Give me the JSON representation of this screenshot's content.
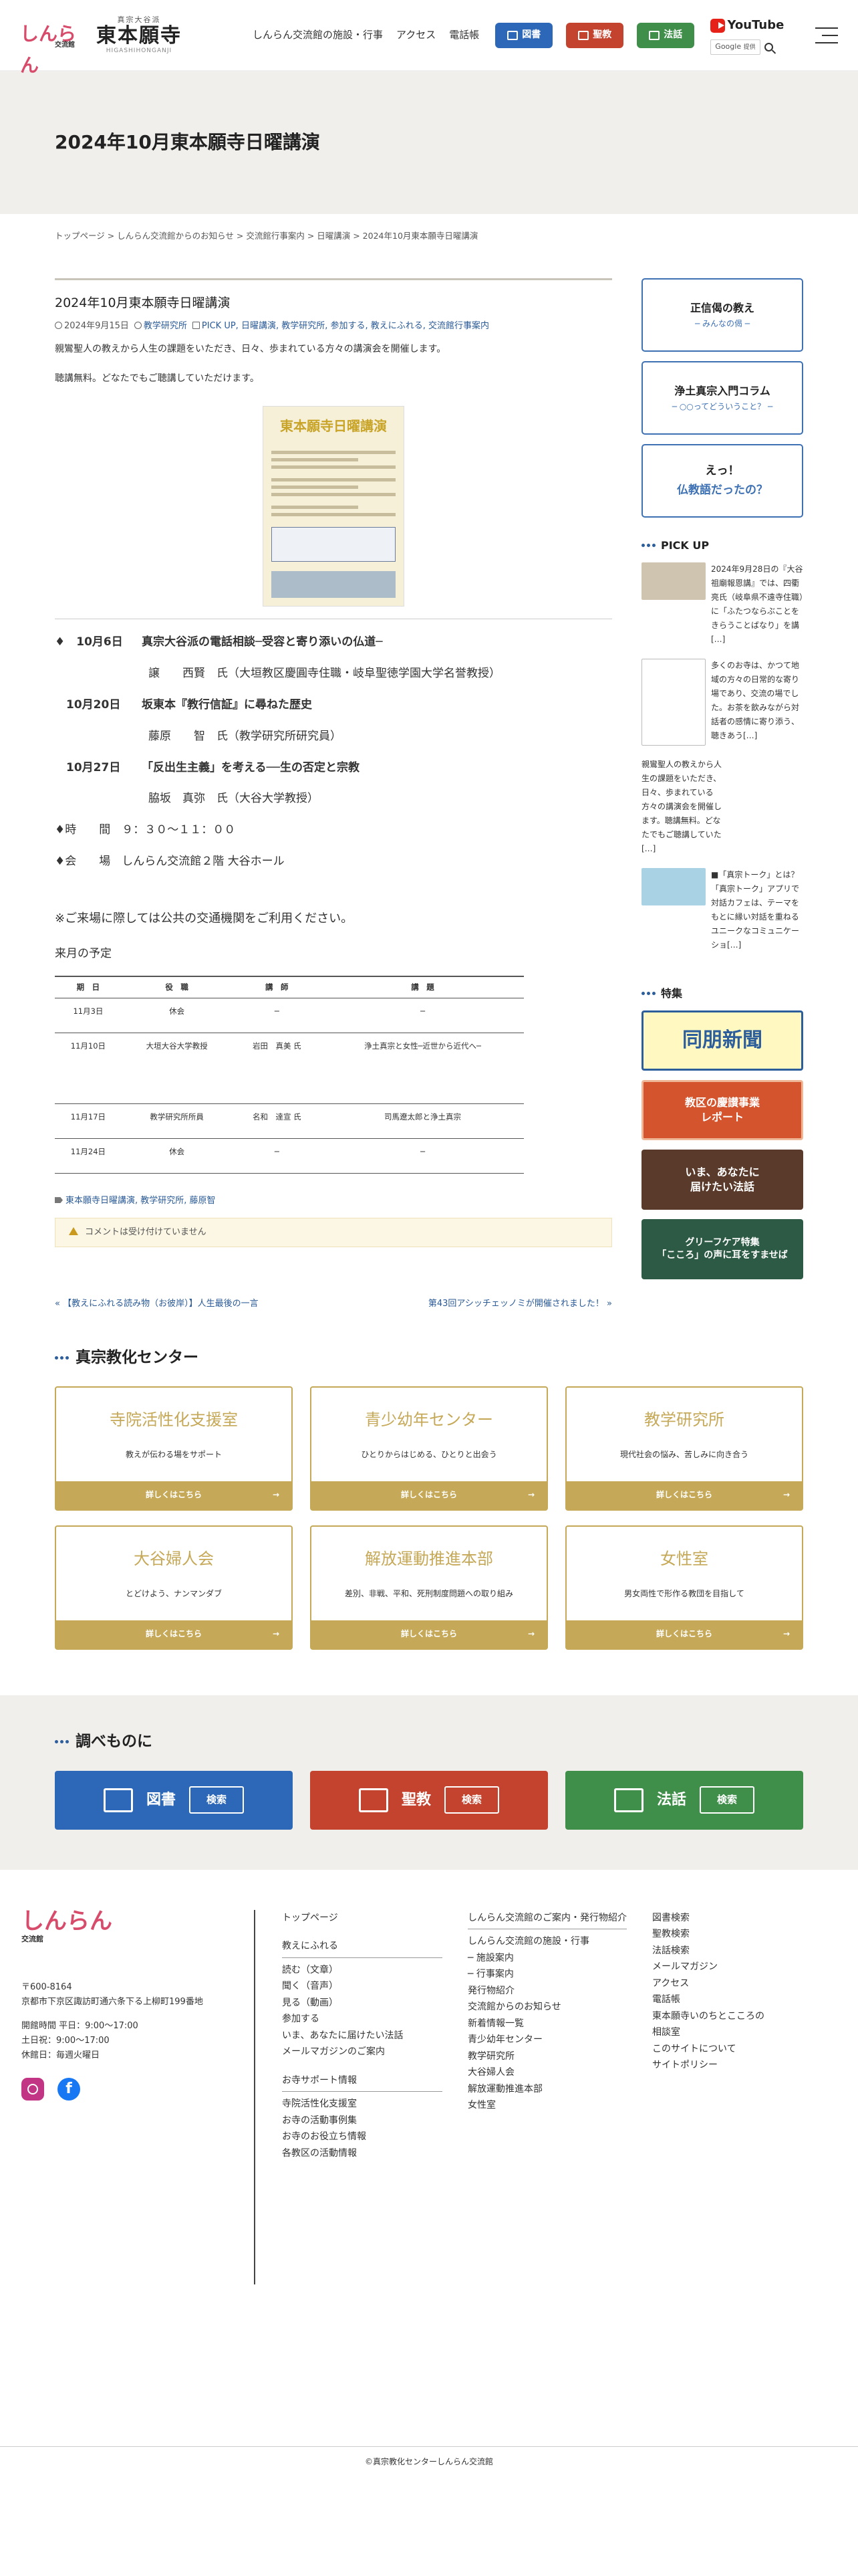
{
  "header": {
    "site_name": "東本願寺",
    "site_small": "真宗大谷派",
    "site_sub": "HIGASHIHONGANJI",
    "logo_text": "しんらん",
    "logo_sub": "交流館",
    "nav": [
      "しんらん交流館の施設・行事",
      "アクセス",
      "電話帳"
    ],
    "btn_tosho": "図書",
    "btn_seikyo": "聖教",
    "btn_hogo": "法話",
    "youtube": "YouTube",
    "google": "Google",
    "google_sub": "提供"
  },
  "page": {
    "title": "2024年10月東本願寺日曜講演",
    "breadcrumb": "トップページ > しんらん交流館からのお知らせ > 交流館行事案内 > 日曜講演 > 2024年10月東本願寺日曜講演"
  },
  "post": {
    "title": "2024年10月東本願寺日曜講演",
    "date": "2024年9月15日",
    "categories": "教学研究所",
    "tags_meta": "PICK UP, 日曜講演, 教学研究所, 参加する, 教えにふれる, 交流館行事案内",
    "p1": "親鸞聖人の教えから人生の課題をいただき、日々、歩まれている方々の講演会を開催します。",
    "p2": "聴講無料。どなたでもご聴講していただけます。",
    "poster_title": "東本願寺日曜講演",
    "schedule": [
      {
        "date": "♦　10月6日",
        "title": "真宗大谷派の電話相談─受容と寄り添いの仏道─",
        "speaker": "譲　　西賢　氏（大垣教区慶圓寺住職・岐阜聖徳学園大学名誉教授）"
      },
      {
        "date": "　10月20日",
        "title": "坂東本『教行信証』に尋ねた歴史",
        "speaker": "藤原　　智　氏（教学研究所研究員）"
      },
      {
        "date": "　10月27日",
        "title": "「反出生主義」を考える──生の否定と宗教",
        "speaker": "脇坂　真弥　氏（大谷大学教授）"
      }
    ],
    "time": "♦時　　間　９：３０〜１１：００",
    "place": "♦会　　場　しんらん交流館２階 大谷ホール",
    "note": "※ご来場に際しては公共の交通機関をご利用ください。",
    "next_label": "来月の予定",
    "table_headers": [
      "期　日",
      "役　職",
      "講　師",
      "講　題"
    ],
    "table_rows": [
      [
        "11月3日",
        "休会",
        "─",
        "─"
      ],
      [
        "11月10日",
        "大垣大谷大学教授",
        "岩田　真美 氏",
        "浄土真宗と女性─近世から近代へ─"
      ],
      [
        "11月17日",
        "教学研究所所員",
        "名和　達宣 氏",
        "司馬遼太郎と浄土真宗"
      ],
      [
        "11月24日",
        "休会",
        "─",
        "─"
      ]
    ],
    "tags": "東本願寺日曜講演, 教学研究所, 藤原智",
    "comment": "コメントは受け付けていません",
    "prev": "« 【教えにふれる読み物（お彼岸）】人生最後の一言",
    "next": "第43回アシッチェッノミが開催されました！ »"
  },
  "sidebar": {
    "box1_a": "正信偈の教え",
    "box1_b": "─ みんなの偈 ─",
    "box2_a": "浄土真宗入門コラム",
    "box2_b": "─ ○○ってどういうこと？ ─",
    "box3_a": "えっ！",
    "box3_b": "仏教語だったの？",
    "pickup_title": "PICK UP",
    "picks": [
      "2024年9月28日の『大谷祖廟報恩講』では、四衢亮氏（岐阜県不遠寺住職）に「ふたつならぶことをきらうことばなり」を講[…]",
      "多くのお寺は、かつて地域の方々の日常的な寄り場であり、交流の場でした。お茶を飲みながら対話者の感情に寄り添う、聴きあう[…]",
      "親鸞聖人の教えから人生の課題をいただき、日々、歩まれている方々の講演会を開催します。聴講無料。どなたでもご聴講していた[…]",
      "■「真宗トーク」とは？「真宗トーク」アプリで対話カフェは、テーマをもとに縁い対話を重ねるユニークなコミュニケーショ[…]"
    ],
    "feature_title": "特集",
    "banners": [
      "同朋新聞",
      "教区の慶讃事業\nレポート",
      "いま、あなたに\n届けたい法話",
      "グリーフケア特集\n「こころ」の声に耳をすませば"
    ]
  },
  "centers": {
    "title": "真宗教化センター",
    "cards": [
      {
        "name": "寺院活性化支援室",
        "sub": "教えが伝わる場をサポート"
      },
      {
        "name": "青少幼年センター",
        "sub": "ひとりからはじめる、ひとりと出会う"
      },
      {
        "name": "教学研究所",
        "sub": "現代社会の悩み、苦しみに向き合う"
      },
      {
        "name": "大谷婦人会",
        "sub": "とどけよう、ナンマンダブ"
      },
      {
        "name": "解放運動推進本部",
        "sub": "差別、非戦、平和、死刑制度問題への取り組み"
      },
      {
        "name": "女性室",
        "sub": "男女両性で形作る教団を目指して"
      }
    ],
    "more": "詳しくはこちら"
  },
  "search": {
    "title": "調べものに",
    "buttons": [
      "図書",
      "聖教",
      "法話"
    ],
    "search_label": "検索"
  },
  "footer": {
    "logo": "しんらん",
    "logo_sub": "交流館",
    "postal": "〒600-8164",
    "address": "京都市下京区諏訪町通六条下る上柳町199番地",
    "hours1": "開館時間 平日：9:00〜17:00",
    "hours2": "土日祝：9:00〜17:00",
    "closed": "休館日：毎週火曜日",
    "col1": [
      "トップページ"
    ],
    "col1_head2": "教えにふれる",
    "col1_b": [
      "読む（文章）",
      "聞く（音声）",
      "見る（動画）",
      "参加する",
      "いま、あなたに届けたい法話",
      "メールマガジンのご案内"
    ],
    "col1_head3": "お寺サポート情報",
    "col1_c": [
      "寺院活性化支援室",
      "お寺の活動事例集",
      "お寺のお役立ち情報",
      "各教区の活動情報"
    ],
    "col2": [
      "しんらん交流館のご案内・発行物紹介",
      "しんらん交流館の施設・行事",
      "─ 施設案内",
      "─ 行事案内",
      "発行物紹介",
      "交流館からのお知らせ",
      "新着情報一覧",
      "青少幼年センター",
      "教学研究所",
      "大谷婦人会",
      "解放運動推進本部",
      "女性室"
    ],
    "col3": [
      "図書検索",
      "聖教検索",
      "法話検索",
      "メールマガジン",
      "アクセス",
      "電話帳",
      "東本願寺いのちとこころの相談室",
      "このサイトについて",
      "サイトポリシー"
    ],
    "copyright": "©真宗教化センターしんらん交流館"
  }
}
